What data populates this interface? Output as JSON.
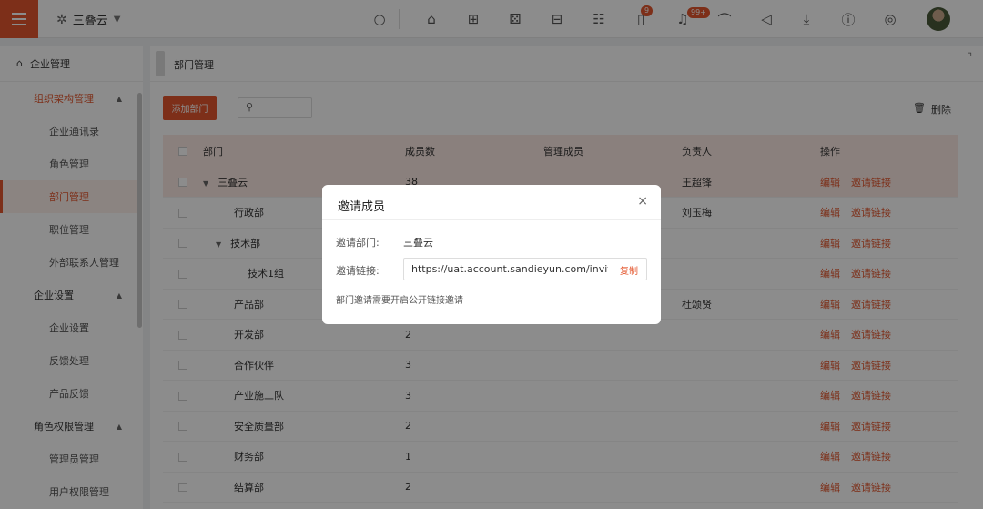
{
  "topbar": {
    "org_name": "三叠云",
    "badges": {
      "todo": "9",
      "notifications": "99+"
    }
  },
  "sidebar": {
    "header": "企业管理",
    "items": [
      {
        "label": "组织架构管理",
        "type": "group"
      },
      {
        "label": "企业通讯录",
        "type": "sub"
      },
      {
        "label": "角色管理",
        "type": "sub"
      },
      {
        "label": "部门管理",
        "type": "sub"
      },
      {
        "label": "职位管理",
        "type": "sub"
      },
      {
        "label": "外部联系人管理",
        "type": "sub"
      },
      {
        "label": "企业设置",
        "type": "group"
      },
      {
        "label": "企业设置",
        "type": "sub"
      },
      {
        "label": "反馈处理",
        "type": "sub"
      },
      {
        "label": "产品反馈",
        "type": "sub"
      },
      {
        "label": "角色权限管理",
        "type": "group"
      },
      {
        "label": "管理员管理",
        "type": "sub"
      },
      {
        "label": "用户权限管理",
        "type": "sub"
      }
    ]
  },
  "breadcrumb": "部门管理",
  "toolbar": {
    "add_label": "添加部门",
    "delete_label": "删除"
  },
  "table": {
    "headers": [
      "部门",
      "成员数",
      "管理成员",
      "负责人",
      "操作"
    ],
    "rows": [
      {
        "name": "三叠云",
        "count": "38",
        "manager": "",
        "owner": "王超锋"
      },
      {
        "name": "行政部",
        "count": "",
        "manager": "",
        "owner": "刘玉梅"
      },
      {
        "name": "技术部",
        "count": "",
        "manager": "",
        "owner": ""
      },
      {
        "name": "技术1组",
        "count": "",
        "manager": "",
        "owner": ""
      },
      {
        "name": "产品部",
        "count": "",
        "manager": "",
        "owner": "杜颂贤"
      },
      {
        "name": "开发部",
        "count": "2",
        "manager": "",
        "owner": ""
      },
      {
        "name": "合作伙伴",
        "count": "3",
        "manager": "",
        "owner": ""
      },
      {
        "name": "产业施工队",
        "count": "3",
        "manager": "",
        "owner": ""
      },
      {
        "name": "安全质量部",
        "count": "2",
        "manager": "",
        "owner": ""
      },
      {
        "name": "财务部",
        "count": "1",
        "manager": "",
        "owner": ""
      },
      {
        "name": "结算部",
        "count": "2",
        "manager": "",
        "owner": ""
      }
    ],
    "op_edit": "编辑",
    "op_invite": "邀请链接"
  },
  "modal": {
    "title": "邀请成员",
    "dept_label": "邀请部门:",
    "dept_value": "三叠云",
    "link_label": "邀请链接:",
    "link_value": "https://uat.account.sandieyun.com/invite?k=",
    "copy_label": "复制",
    "hint": "部门邀请需要开启公开链接邀请"
  }
}
